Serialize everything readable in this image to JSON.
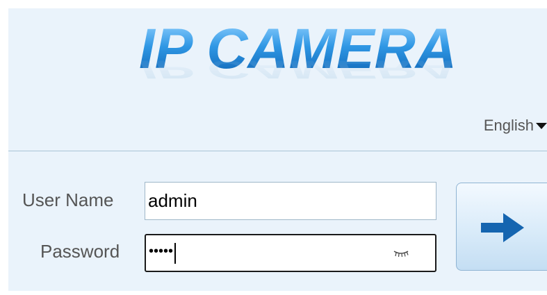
{
  "logo": {
    "text": "IP CAMERA"
  },
  "language": {
    "selected": "English"
  },
  "login": {
    "username_label": "User Name",
    "username_value": "admin",
    "password_label": "Password",
    "password_masked": "•••••"
  },
  "icons": {
    "language_dropdown": "caret-down-icon",
    "password_toggle": "eye-closed-icon",
    "submit": "arrow-right-icon"
  },
  "colors": {
    "panel_bg": "#eaf3fb",
    "logo_blue": "#1e88d8",
    "arrow_blue": "#1565b0"
  }
}
